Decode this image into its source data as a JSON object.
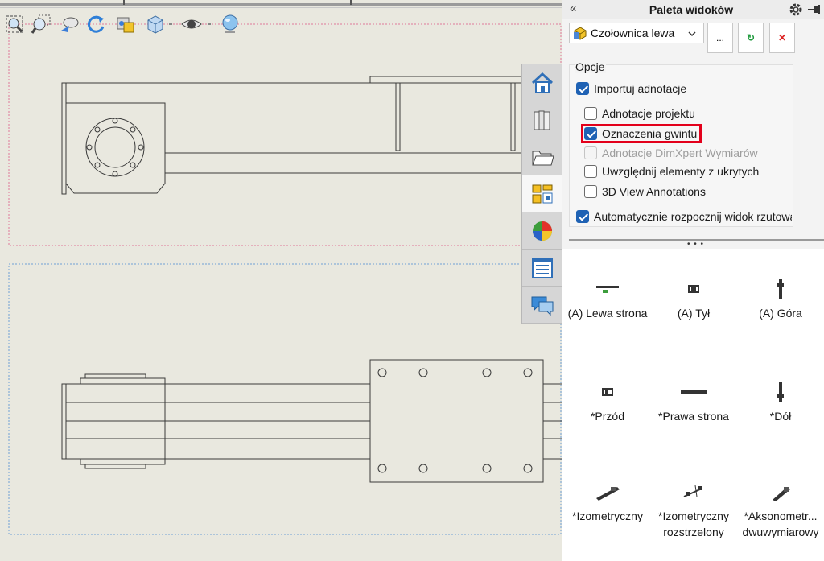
{
  "panel": {
    "title": "Paleta widoków",
    "collapse_glyph": "«",
    "document_select": {
      "value": "Czołownica lewa",
      "icon": "part-document-icon"
    },
    "buttons": [
      {
        "name": "browse",
        "label": "..."
      },
      {
        "name": "refresh",
        "label": "↻",
        "icon": "refresh-icon"
      },
      {
        "name": "clear",
        "label": "✕",
        "icon": "clear-icon"
      }
    ]
  },
  "options": {
    "title": "Opcje",
    "items": [
      {
        "label": "Importuj adnotacje",
        "checked": true,
        "disabled": false
      },
      {
        "label": "Adnotacje projektu",
        "checked": false,
        "disabled": false
      },
      {
        "label": "Oznaczenia gwintu",
        "checked": true,
        "disabled": false
      },
      {
        "label": "Adnotacje DimXpert Wymiarów",
        "checked": false,
        "disabled": true
      },
      {
        "label": "Uwzględnij elementy z ukrytych",
        "checked": false,
        "disabled": false
      },
      {
        "label": "3D View Annotations",
        "checked": false,
        "disabled": false
      },
      {
        "label": "Automatycznie rozpocznij widok rzutowany",
        "checked": true,
        "disabled": false
      }
    ]
  },
  "views": [
    {
      "label": "(A) Lewa strona"
    },
    {
      "label": "(A) Tył"
    },
    {
      "label": "(A) Góra"
    },
    {
      "label": "*Przód"
    },
    {
      "label": "*Prawa strona"
    },
    {
      "label": "*Dół"
    },
    {
      "label": "*Izometryczny"
    },
    {
      "label": "*Izometryczny rozstrzelony"
    },
    {
      "label": "*Aksonometr... dwuwymiarowy"
    }
  ],
  "toolbar_icons": [
    "zoom-to-fit-icon",
    "zoom-area-icon",
    "previous-view-icon",
    "rotate-icon",
    "pan-icon",
    "view-orientation-icon",
    "hide-show-icon",
    "appearance-icon"
  ],
  "task_tabs": [
    "home-icon",
    "design-library-icon",
    "file-explorer-icon",
    "view-palette-icon",
    "appearances-icon",
    "custom-properties-icon",
    "forum-icon"
  ],
  "colors": {
    "highlight": "#e3001b",
    "checkbox": "#1f62b4",
    "sheet_background": "#e9e8df"
  }
}
